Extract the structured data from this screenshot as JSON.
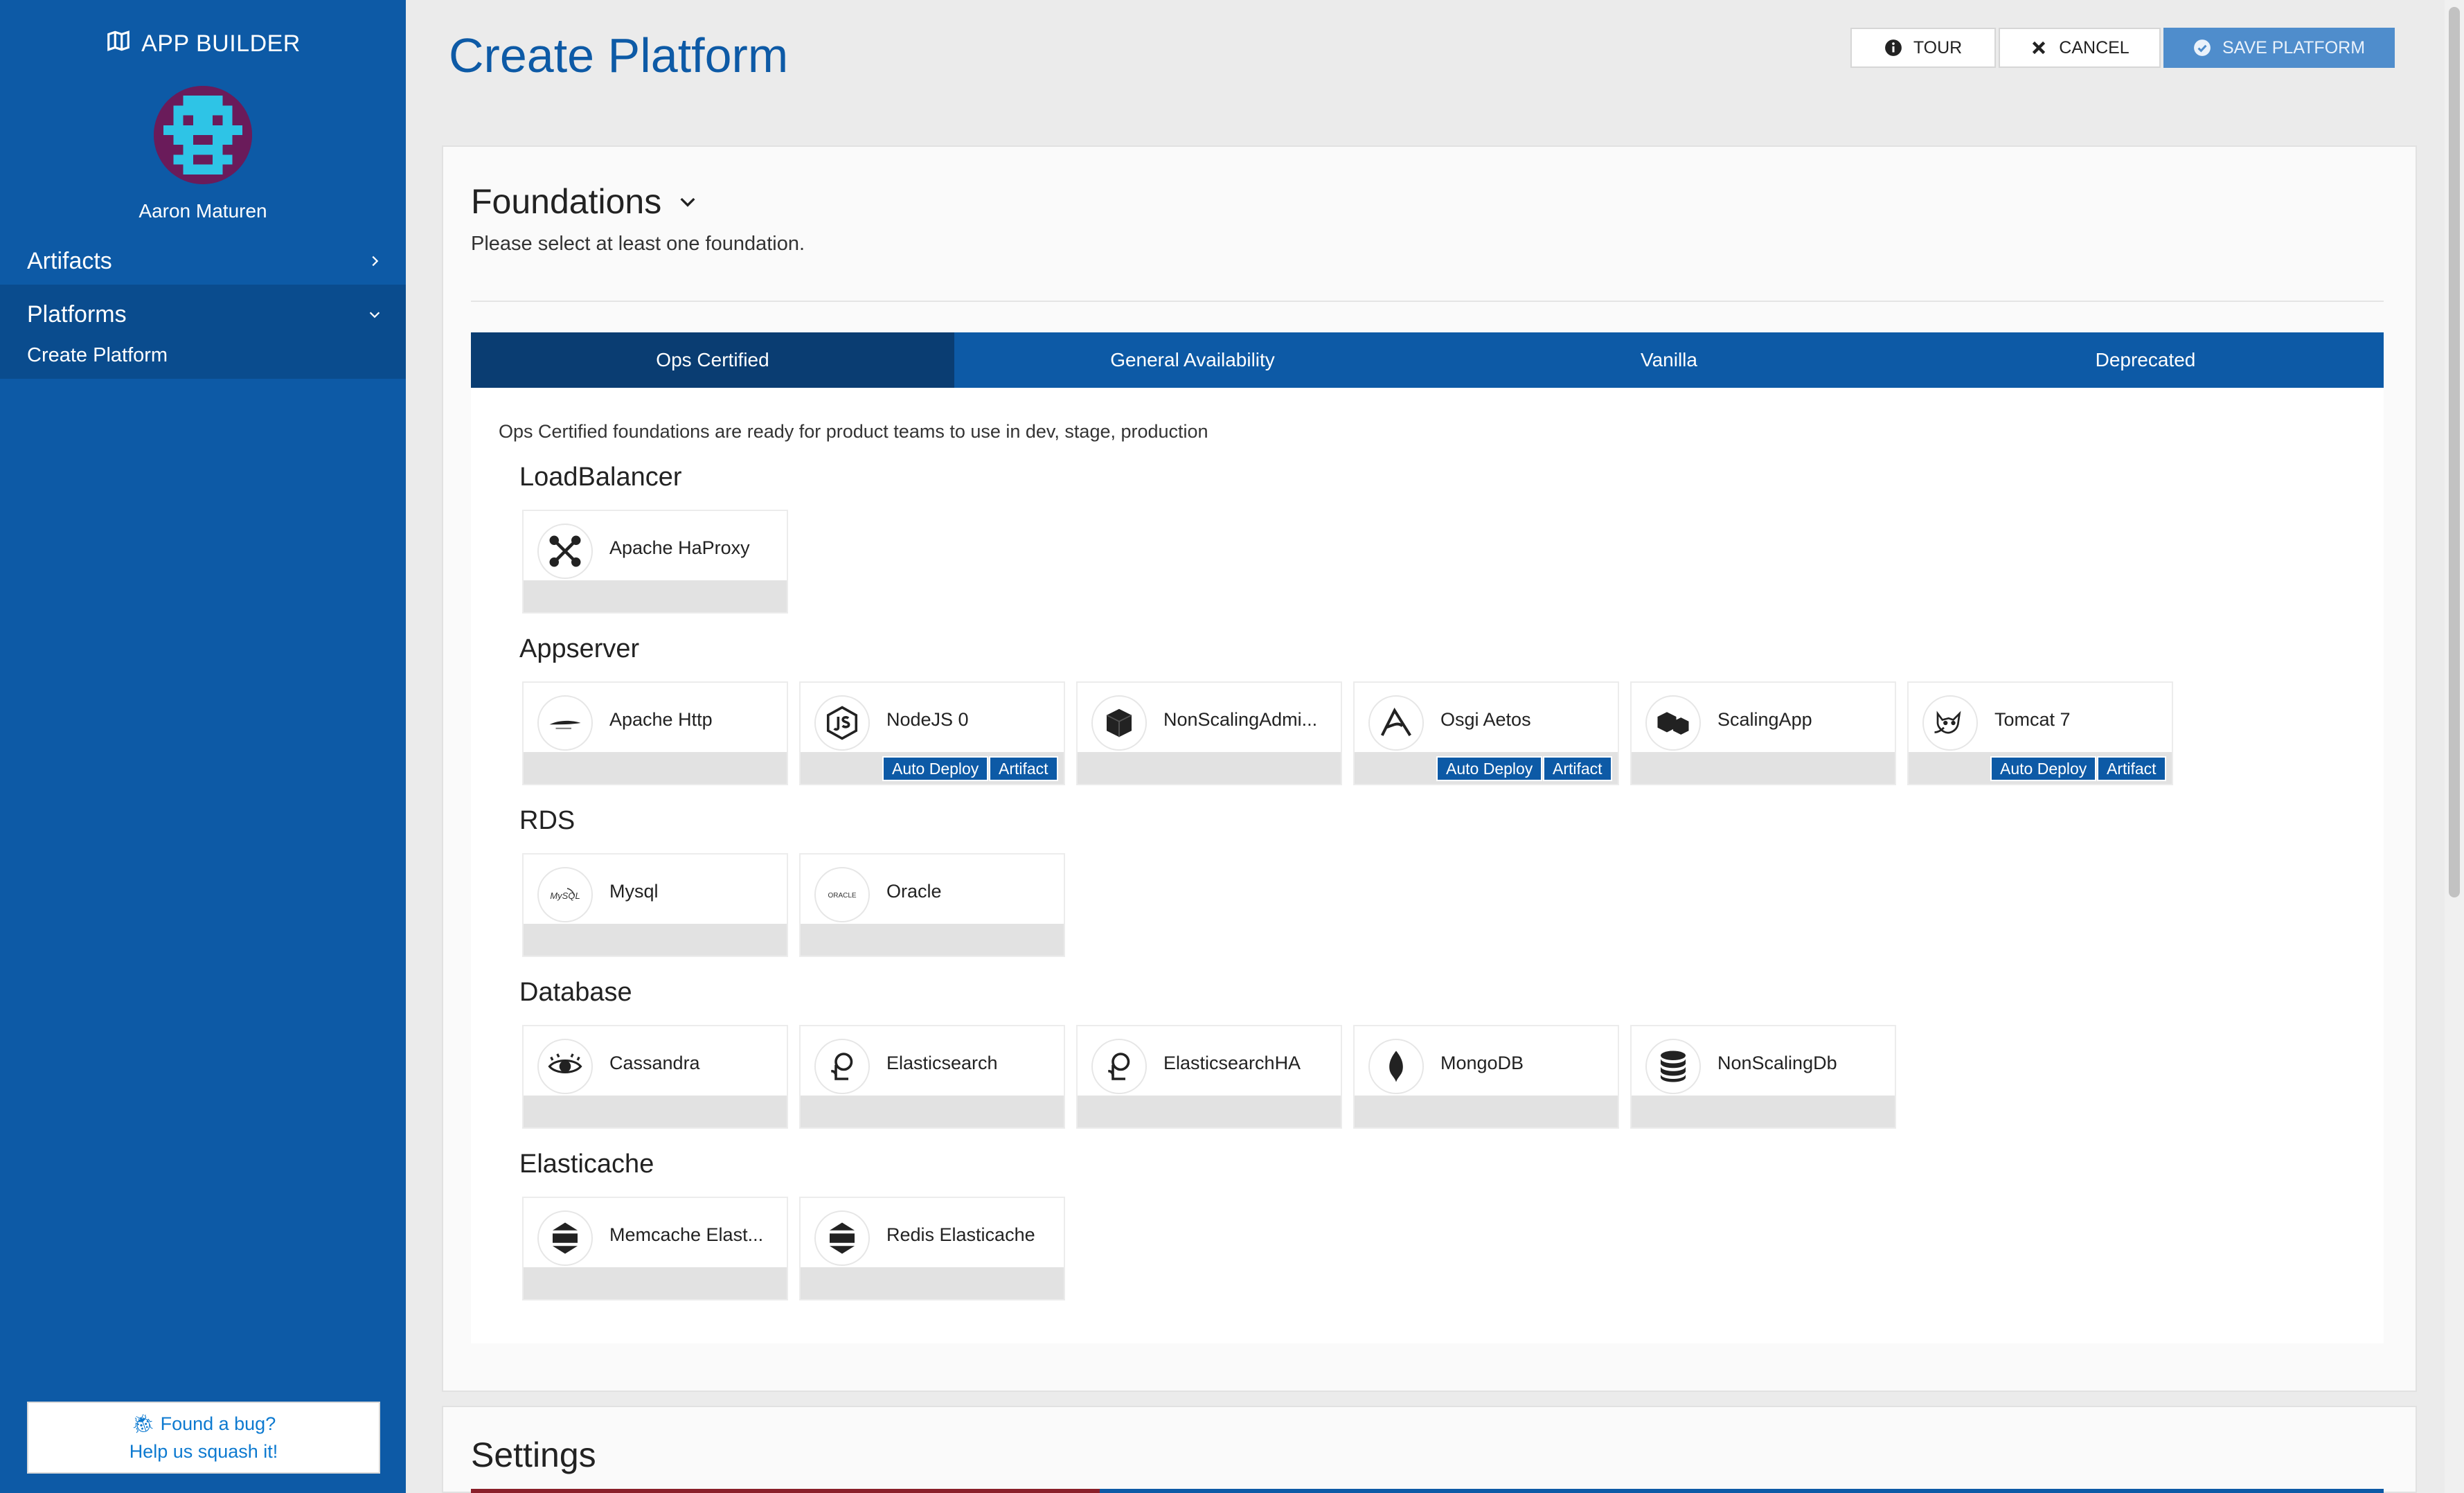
{
  "sidebar": {
    "brand": "APP BUILDER",
    "username": "Aaron Maturen",
    "items": [
      {
        "label": "Artifacts"
      },
      {
        "label": "Platforms",
        "sub": "Create Platform"
      }
    ],
    "bug": {
      "line1": "Found a bug?",
      "line2": "Help us squash it!"
    }
  },
  "header": {
    "title": "Create Platform",
    "tour": "TOUR",
    "cancel": "CANCEL",
    "save": "SAVE PLATFORM"
  },
  "foundations": {
    "title": "Foundations",
    "description": "Please select at least one foundation.",
    "tabs": [
      "Ops Certified",
      "General Availability",
      "Vanilla",
      "Deprecated"
    ],
    "tab_description": "Ops Certified foundations are ready for product teams to use in dev, stage, production",
    "categories": [
      {
        "title": "LoadBalancer",
        "items": [
          {
            "name": "Apache HaProxy",
            "icon": "haproxy-icon"
          }
        ]
      },
      {
        "title": "Appserver",
        "items": [
          {
            "name": "Apache Http",
            "icon": "apache-feather-icon"
          },
          {
            "name": "NodeJS 0",
            "icon": "nodejs-icon",
            "badges": [
              "Auto Deploy",
              "Artifact"
            ]
          },
          {
            "name": "NonScalingAdmi...",
            "icon": "cube-icon"
          },
          {
            "name": "Osgi Aetos",
            "icon": "osgi-icon",
            "badges": [
              "Auto Deploy",
              "Artifact"
            ]
          },
          {
            "name": "ScalingApp",
            "icon": "cubes-icon"
          },
          {
            "name": "Tomcat 7",
            "icon": "tomcat-icon",
            "badges": [
              "Auto Deploy",
              "Artifact"
            ]
          }
        ]
      },
      {
        "title": "RDS",
        "items": [
          {
            "name": "Mysql",
            "icon": "mysql-icon",
            "icon_text": "MySQL"
          },
          {
            "name": "Oracle",
            "icon": "oracle-icon",
            "icon_text": "ORACLE"
          }
        ]
      },
      {
        "title": "Database",
        "items": [
          {
            "name": "Cassandra",
            "icon": "cassandra-eye-icon"
          },
          {
            "name": "Elasticsearch",
            "icon": "elasticsearch-icon"
          },
          {
            "name": "ElasticsearchHA",
            "icon": "elasticsearch-icon"
          },
          {
            "name": "MongoDB",
            "icon": "mongodb-leaf-icon"
          },
          {
            "name": "NonScalingDb",
            "icon": "database-icon"
          }
        ]
      },
      {
        "title": "Elasticache",
        "items": [
          {
            "name": "Memcache Elast...",
            "icon": "elasticache-icon"
          },
          {
            "name": "Redis Elasticache",
            "icon": "elasticache-icon"
          }
        ]
      }
    ]
  },
  "settings": {
    "title": "Settings"
  },
  "colors": {
    "primary": "#0d5aa6",
    "active_tab": "#0a3d72",
    "save": "#4f8dcc"
  }
}
